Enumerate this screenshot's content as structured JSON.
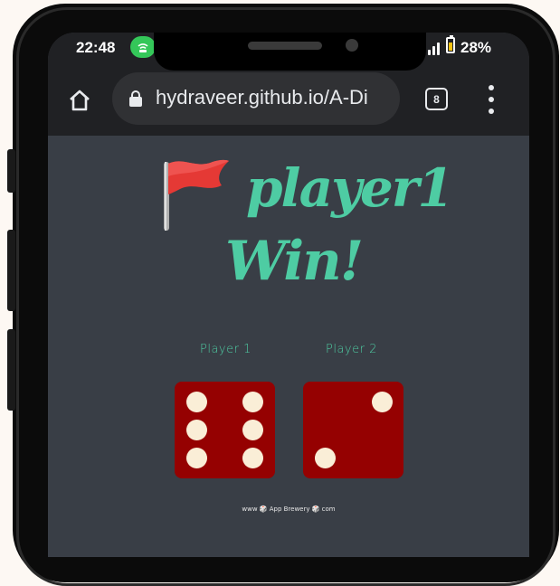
{
  "status_bar": {
    "time": "22:48",
    "battery_percent": "28%",
    "battery_level": 0.28,
    "icons": [
      "hotspot-icon",
      "signal-icon",
      "battery-icon"
    ]
  },
  "browser": {
    "url": "hydraveer.github.io/A-Di",
    "tab_count": "8",
    "icons": [
      "home-icon",
      "lock-icon",
      "tabs-icon",
      "more-vert-icon"
    ]
  },
  "game": {
    "result_line1": "player1",
    "result_line2": "Win!",
    "result_icon": "red-flag-icon",
    "players": [
      {
        "label": "Player 1",
        "dice_value": 6
      },
      {
        "label": "Player 2",
        "dice_value": 2
      }
    ],
    "footer": "www 🎲 App Brewery 🎲 com"
  },
  "colors": {
    "background": "#393e46",
    "accent": "#4ecca3",
    "dice": "#950101",
    "pip": "#faeed7",
    "browser_bar": "#202124"
  }
}
